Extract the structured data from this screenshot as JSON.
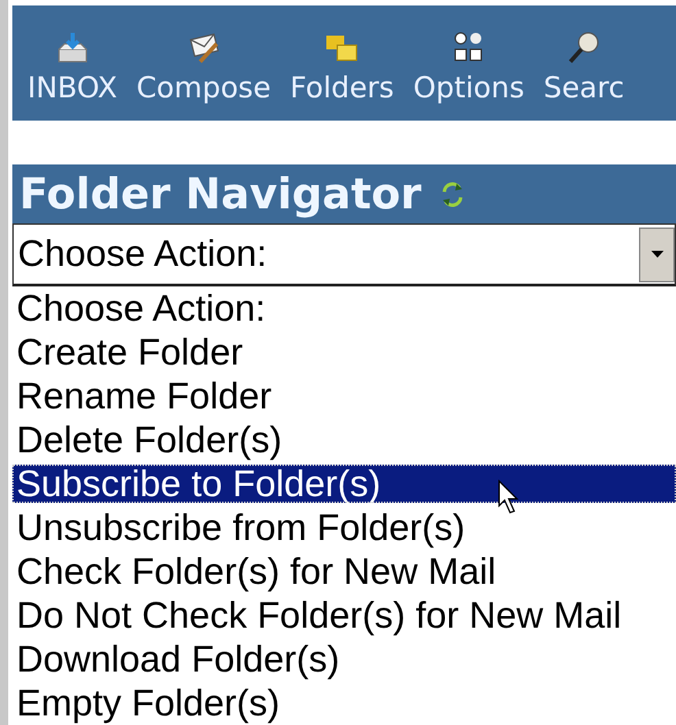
{
  "toolbar": [
    {
      "label": "INBOX",
      "kind": "inbox"
    },
    {
      "label": "Compose",
      "kind": "compose"
    },
    {
      "label": "Folders",
      "kind": "folders"
    },
    {
      "label": "Options",
      "kind": "options"
    },
    {
      "label": "Searc",
      "kind": "search"
    }
  ],
  "panel": {
    "title": "Folder Navigator"
  },
  "action_select": {
    "value": "Choose Action:"
  },
  "options": [
    {
      "label": "Choose Action:",
      "selected": false
    },
    {
      "label": "Create Folder",
      "selected": false
    },
    {
      "label": "Rename Folder",
      "selected": false
    },
    {
      "label": "Delete Folder(s)",
      "selected": false
    },
    {
      "label": "Subscribe to Folder(s)",
      "selected": true
    },
    {
      "label": "Unsubscribe from Folder(s)",
      "selected": false
    },
    {
      "label": "Check Folder(s) for New Mail",
      "selected": false
    },
    {
      "label": "Do Not Check Folder(s) for New Mail",
      "selected": false
    },
    {
      "label": "Download Folder(s)",
      "selected": false
    },
    {
      "label": "Empty Folder(s)",
      "selected": false
    }
  ]
}
